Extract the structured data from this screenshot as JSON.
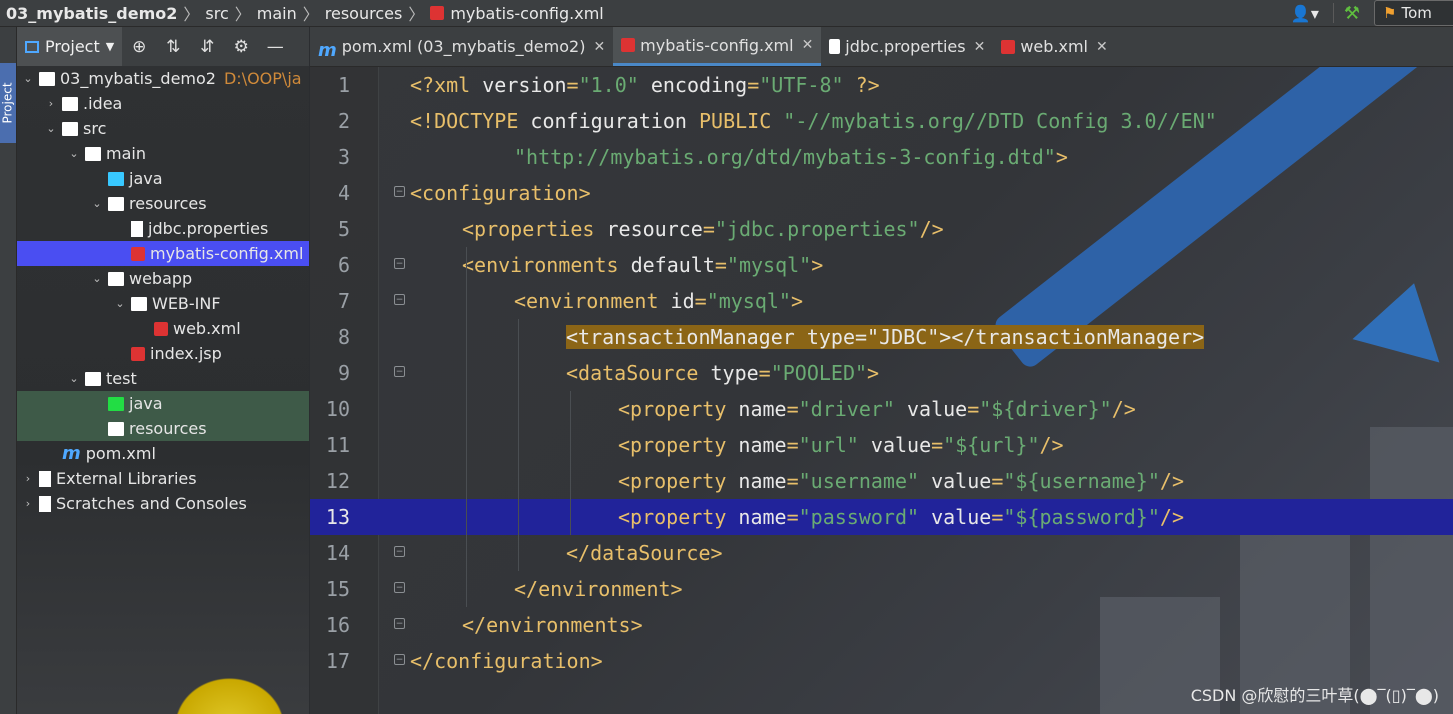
{
  "breadcrumb": {
    "project": "03_mybatis_demo2",
    "parts": [
      "src",
      "main",
      "resources",
      "mybatis-config.xml"
    ]
  },
  "run_config": {
    "label": "Tom"
  },
  "tool_window": {
    "stripe_label": "Project",
    "title": "Project"
  },
  "tree": {
    "items": [
      {
        "label": "03_mybatis_demo2",
        "extra": "D:\\OOP\\ja",
        "depth": 0,
        "expanded": true,
        "icon": "module-folder-icon"
      },
      {
        "label": ".idea",
        "depth": 1,
        "expanded": false,
        "icon": "folder-icon"
      },
      {
        "label": "src",
        "depth": 1,
        "expanded": true,
        "icon": "folder-icon"
      },
      {
        "label": "main",
        "depth": 2,
        "expanded": true,
        "icon": "folder-icon"
      },
      {
        "label": "java",
        "depth": 3,
        "icon": "source-folder-icon"
      },
      {
        "label": "resources",
        "depth": 3,
        "expanded": true,
        "icon": "resources-folder-icon"
      },
      {
        "label": "jdbc.properties",
        "depth": 4,
        "icon": "properties-file-icon"
      },
      {
        "label": "mybatis-config.xml",
        "depth": 4,
        "icon": "xml-file-icon",
        "selected": true
      },
      {
        "label": "webapp",
        "depth": 3,
        "expanded": true,
        "icon": "web-folder-icon"
      },
      {
        "label": "WEB-INF",
        "depth": 4,
        "expanded": true,
        "icon": "folder-icon"
      },
      {
        "label": "web.xml",
        "depth": 5,
        "icon": "xml-file-icon"
      },
      {
        "label": "index.jsp",
        "depth": 4,
        "icon": "jsp-file-icon"
      },
      {
        "label": "test",
        "depth": 2,
        "expanded": true,
        "icon": "folder-icon"
      },
      {
        "label": "java",
        "depth": 3,
        "icon": "test-source-folder-icon",
        "green": true
      },
      {
        "label": "resources",
        "depth": 3,
        "icon": "test-resources-folder-icon",
        "green": true
      },
      {
        "label": "pom.xml",
        "depth": 1,
        "icon": "maven-icon"
      },
      {
        "label": "External Libraries",
        "depth": 0,
        "expanded": false,
        "icon": "libraries-icon"
      },
      {
        "label": "Scratches and Consoles",
        "depth": 0,
        "expanded": false,
        "icon": "scratches-icon"
      }
    ]
  },
  "tabs": [
    {
      "label": "pom.xml (03_mybatis_demo2)",
      "icon": "maven-icon",
      "active": false
    },
    {
      "label": "mybatis-config.xml",
      "icon": "xml-file-icon",
      "active": true
    },
    {
      "label": "jdbc.properties",
      "icon": "properties-file-icon",
      "active": false
    },
    {
      "label": "web.xml",
      "icon": "xml-file-icon",
      "active": false
    }
  ],
  "editor": {
    "current_line": 13,
    "lines": [
      {
        "n": "1",
        "indent": 0,
        "parts": [
          [
            "t",
            "<?xml "
          ],
          [
            "a",
            "version"
          ],
          [
            "t",
            "="
          ],
          [
            "v",
            "\"1.0\""
          ],
          [
            "a",
            " encoding"
          ],
          [
            "t",
            "="
          ],
          [
            "v",
            "\"UTF-8\""
          ],
          [
            "t",
            " ?>"
          ]
        ]
      },
      {
        "n": "2",
        "indent": 0,
        "parts": [
          [
            "t",
            "<!DOCTYPE "
          ],
          [
            "a",
            "configuration "
          ],
          [
            "t",
            "PUBLIC "
          ],
          [
            "v",
            "\"-//mybatis.org//DTD Config 3.0//EN\""
          ]
        ]
      },
      {
        "n": "3",
        "indent": 8,
        "parts": [
          [
            "v",
            "\"http://mybatis.org/dtd/mybatis-3-config.dtd\""
          ],
          [
            "t",
            ">"
          ]
        ]
      },
      {
        "n": "4",
        "indent": 0,
        "parts": [
          [
            "t",
            "<configuration>"
          ]
        ]
      },
      {
        "n": "5",
        "indent": 4,
        "parts": [
          [
            "t",
            "<properties "
          ],
          [
            "a",
            "resource"
          ],
          [
            "t",
            "="
          ],
          [
            "v",
            "\"jdbc.properties\""
          ],
          [
            "t",
            "/>"
          ]
        ]
      },
      {
        "n": "6",
        "indent": 4,
        "parts": [
          [
            "t",
            "<environments "
          ],
          [
            "a",
            "default"
          ],
          [
            "t",
            "="
          ],
          [
            "v",
            "\"mysql\""
          ],
          [
            "t",
            ">"
          ]
        ]
      },
      {
        "n": "7",
        "indent": 8,
        "parts": [
          [
            "t",
            "<environment "
          ],
          [
            "a",
            "id"
          ],
          [
            "t",
            "="
          ],
          [
            "v",
            "\"mysql\""
          ],
          [
            "t",
            ">"
          ]
        ]
      },
      {
        "n": "8",
        "indent": 12,
        "highlight": true,
        "parts": [
          [
            "a",
            "<transactionManager type=\"JDBC\"></transactionManager>"
          ]
        ]
      },
      {
        "n": "9",
        "indent": 12,
        "parts": [
          [
            "t",
            "<dataSource "
          ],
          [
            "a",
            "type"
          ],
          [
            "t",
            "="
          ],
          [
            "v",
            "\"POOLED\""
          ],
          [
            "t",
            ">"
          ]
        ]
      },
      {
        "n": "10",
        "indent": 16,
        "parts": [
          [
            "t",
            "<property "
          ],
          [
            "a",
            "name"
          ],
          [
            "t",
            "="
          ],
          [
            "v",
            "\"driver\""
          ],
          [
            "a",
            " value"
          ],
          [
            "t",
            "="
          ],
          [
            "v",
            "\"${driver}\""
          ],
          [
            "t",
            "/>"
          ]
        ]
      },
      {
        "n": "11",
        "indent": 16,
        "parts": [
          [
            "t",
            "<property "
          ],
          [
            "a",
            "name"
          ],
          [
            "t",
            "="
          ],
          [
            "v",
            "\"url\""
          ],
          [
            "a",
            " value"
          ],
          [
            "t",
            "="
          ],
          [
            "v",
            "\"${url}\""
          ],
          [
            "t",
            "/>"
          ]
        ]
      },
      {
        "n": "12",
        "indent": 16,
        "parts": [
          [
            "t",
            "<property "
          ],
          [
            "a",
            "name"
          ],
          [
            "t",
            "="
          ],
          [
            "v",
            "\"username\""
          ],
          [
            "a",
            " value"
          ],
          [
            "t",
            "="
          ],
          [
            "v",
            "\"${username}\""
          ],
          [
            "t",
            "/>"
          ]
        ]
      },
      {
        "n": "13",
        "indent": 16,
        "parts": [
          [
            "t",
            "<property "
          ],
          [
            "a",
            "name"
          ],
          [
            "t",
            "="
          ],
          [
            "v",
            "\"password\""
          ],
          [
            "a",
            " value"
          ],
          [
            "t",
            "="
          ],
          [
            "v",
            "\"${password}\""
          ],
          [
            "t",
            "/>"
          ]
        ]
      },
      {
        "n": "14",
        "indent": 12,
        "parts": [
          [
            "t",
            "</dataSource>"
          ]
        ]
      },
      {
        "n": "15",
        "indent": 8,
        "parts": [
          [
            "t",
            "</environment>"
          ]
        ]
      },
      {
        "n": "16",
        "indent": 4,
        "parts": [
          [
            "t",
            "</environments>"
          ]
        ]
      },
      {
        "n": "17",
        "indent": 0,
        "parts": [
          [
            "t",
            "</configuration>"
          ]
        ]
      }
    ],
    "folds": [
      "4",
      "6",
      "7",
      "9",
      "14",
      "15",
      "16",
      "17"
    ]
  },
  "watermark": "CSDN @欣慰的三叶草(⬤‾(▯)‾⬤)",
  "colors": {
    "selection": "#4a4ef2",
    "current_line": "#21239a",
    "highlight": "#8b6516",
    "tag": "#e8bf6a",
    "value": "#6aab73"
  }
}
